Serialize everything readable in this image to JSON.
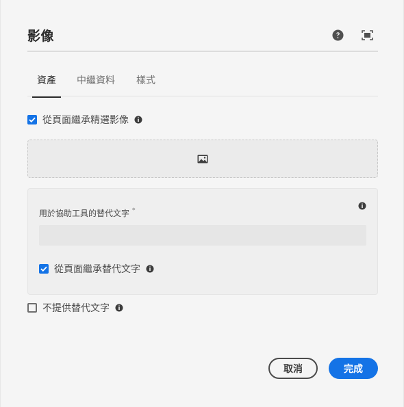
{
  "dialog": {
    "title": "影像",
    "icons": {
      "help": "help-icon",
      "fullscreen": "fullscreen-icon"
    }
  },
  "tabs": [
    {
      "label": "資產",
      "active": true
    },
    {
      "label": "中繼資料",
      "active": false
    },
    {
      "label": "樣式",
      "active": false
    }
  ],
  "asset": {
    "inherit_featured_image": {
      "label": "從頁面繼承精選影像",
      "checked": true
    },
    "dropzone_icon": "image-icon",
    "alt_text": {
      "label": "用於協助工具的替代文字",
      "required_marker": "*",
      "value": "",
      "inherit_alt": {
        "label": "從頁面繼承替代文字",
        "checked": true
      }
    },
    "no_alt": {
      "label": "不提供替代文字",
      "checked": false
    }
  },
  "footer": {
    "cancel_label": "取消",
    "done_label": "完成"
  },
  "colors": {
    "accent": "#1473e6",
    "text": "#2c2c2c",
    "background": "#f5f5f5"
  }
}
